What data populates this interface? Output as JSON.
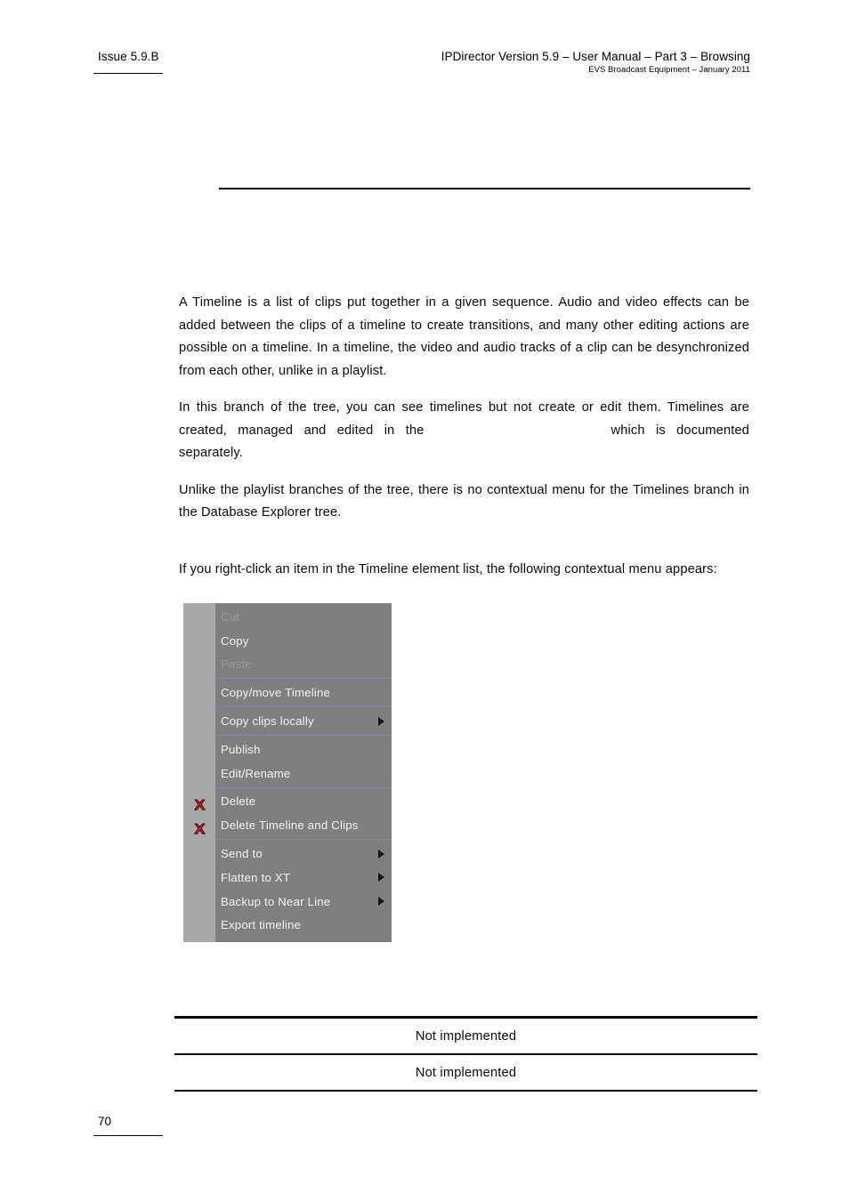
{
  "header": {
    "issue": "Issue 5.9.B",
    "title": "IPDirector Version 5.9 – User Manual – Part 3 – Browsing",
    "subtitle": "EVS Broadcast Equipment – January 2011"
  },
  "body": {
    "paragraph_1": "A Timeline is a list of clips put together in a given sequence. Audio and video effects can be added between the clips of a timeline to create transitions, and many other editing actions are possible on a timeline. In a timeline, the video and audio tracks of a clip can be desynchronized from each other, unlike in a playlist.",
    "paragraph_2_part_1": "In this branch of the tree, you can see timelines but not create or edit them. Timelines are created, managed and edited in the",
    "paragraph_2_part_2": "which is documented separately.",
    "paragraph_3": "Unlike the playlist branches of the tree, there is no contextual menu for the Timelines branch in the Database Explorer tree.",
    "paragraph_4": "If you right-click an item in the Timeline element list, the following contextual menu appears:"
  },
  "context_menu": {
    "background_color": "#7f7f7f",
    "gutter_color": "#a8a8a8",
    "separator_color": "#6b8cc4",
    "text_color": "#f2f2f2",
    "disabled_text_color": "#9e9a93",
    "icon_color": "#d91f21",
    "items": [
      {
        "label": "Cut",
        "disabled": true,
        "submenu": false,
        "icon": null,
        "separator_after": false
      },
      {
        "label": "Copy",
        "disabled": false,
        "submenu": false,
        "icon": null,
        "separator_after": false
      },
      {
        "label": "Paste",
        "disabled": true,
        "submenu": false,
        "icon": null,
        "separator_after": true
      },
      {
        "label": "Copy/move Timeline",
        "disabled": false,
        "submenu": false,
        "icon": null,
        "separator_after": true
      },
      {
        "label": "Copy clips locally",
        "disabled": false,
        "submenu": true,
        "icon": null,
        "separator_after": true
      },
      {
        "label": "Publish",
        "disabled": false,
        "submenu": false,
        "icon": null,
        "separator_after": false
      },
      {
        "label": "Edit/Rename",
        "disabled": false,
        "submenu": false,
        "icon": null,
        "separator_after": true
      },
      {
        "label": "Delete",
        "disabled": false,
        "submenu": false,
        "icon": "red-x-icon",
        "separator_after": false
      },
      {
        "label": "Delete Timeline and Clips",
        "disabled": false,
        "submenu": false,
        "icon": "red-x-icon",
        "separator_after": true
      },
      {
        "label": "Send to",
        "disabled": false,
        "submenu": true,
        "icon": null,
        "separator_after": false
      },
      {
        "label": "Flatten to XT",
        "disabled": false,
        "submenu": true,
        "icon": null,
        "separator_after": false
      },
      {
        "label": "Backup to Near Line",
        "disabled": false,
        "submenu": true,
        "icon": null,
        "separator_after": false
      },
      {
        "label": "Export timeline",
        "disabled": false,
        "submenu": false,
        "icon": null,
        "separator_after": false
      }
    ]
  },
  "table": {
    "rows": [
      {
        "text": "Not implemented"
      },
      {
        "text": "Not implemented"
      }
    ]
  },
  "footer": {
    "page_number": "70"
  }
}
